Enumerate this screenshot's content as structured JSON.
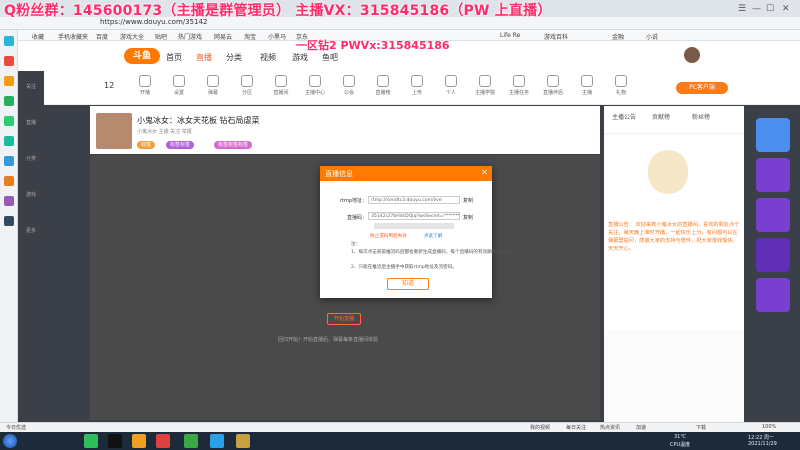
{
  "overlay": {
    "banner": "Q粉丝群：145600173（主播是群管理员）  主播VX：315845186（PW 上直播）",
    "banner2": "一区钻2 PWVx:315845186"
  },
  "browser": {
    "url": "https://www.douyu.com/35142",
    "win_controls": [
      "☰",
      "—",
      "☐",
      "✕"
    ],
    "bookmarks": [
      "收藏",
      "手机收藏夹",
      "百度",
      "游戏大全",
      "贴吧",
      "热门游戏",
      "网易云",
      "淘宝",
      "小黑马",
      "京东",
      "Life Re",
      "游戏百科",
      "金融",
      "小说"
    ]
  },
  "site": {
    "logo": "斗鱼",
    "nav": [
      "首页",
      "直播",
      "分类",
      "视频",
      "游戏",
      "鱼吧"
    ],
    "nav_active_index": 1,
    "tools": [
      "开播",
      "设置",
      "弹幕",
      "分区",
      "直播间",
      "主播中心",
      "公会",
      "直播榜",
      "上传",
      "个人",
      "主播学院",
      "主播任务",
      "直播伴侣",
      "主播",
      "礼物"
    ],
    "pc_button": "PC客户端",
    "level": "12"
  },
  "room": {
    "title": "小鬼冰女：冰女天花板 钻石局虐菜",
    "meta": "小鬼冰女   主播   关注   举报",
    "chips": [
      "标签",
      "标签标签",
      "标签标签标签"
    ],
    "player_button": "开始直播",
    "player_tip": "回归开始！开始直播后，弹幕每条直播间体验"
  },
  "side": {
    "items": [
      "关注",
      "直播",
      "分类",
      "游戏",
      "更多"
    ]
  },
  "right_panel": {
    "tabs": [
      "主播公告",
      "贡献榜",
      "粉丝榜"
    ],
    "notice": "直播公告： 欢迎来到小鬼冰女的直播间，喜欢的朋友点个关注，每天晚上准时开播，一起快乐上分，有问题可以在弹幕里提问，感谢大家的支持与陪伴，祝大家游戏愉快，天天开心。"
  },
  "dialog": {
    "title": "直播信息",
    "close": "✕",
    "rtmp_label": "rtmp地址：",
    "rtmp_value": "rtmp://sendtc3.douyu.com/live",
    "key_label": "直播码：",
    "key_value": "35142r27bHdcDQjq?wsSecret=*******",
    "copy": "复制",
    "link1": "防止遗码用后失效",
    "link2": "点此了解",
    "notes": [
      "注：",
      "1、每次点击获取推流码后都会重新生成直播码，每个直播码的有效期为30分钟。",
      "2、只能在推流后主播手中获取rtmp地址及流密码。"
    ],
    "ok": "知道"
  },
  "statusbar": {
    "left": "今日优选",
    "right": [
      "我的视频",
      "每日关注",
      "热点资讯",
      "加速",
      "下载",
      "100%"
    ]
  },
  "taskbar": {
    "tray_text1": "31℃",
    "tray_text2": "CPU温度",
    "clock": "12:22 周一",
    "date": "2021/11/29"
  },
  "colors": {
    "accent": "#ff7a00",
    "banner": "#ff2b6a",
    "player_bg": "#4a4a4a",
    "page_bg": "#3b3f47"
  }
}
